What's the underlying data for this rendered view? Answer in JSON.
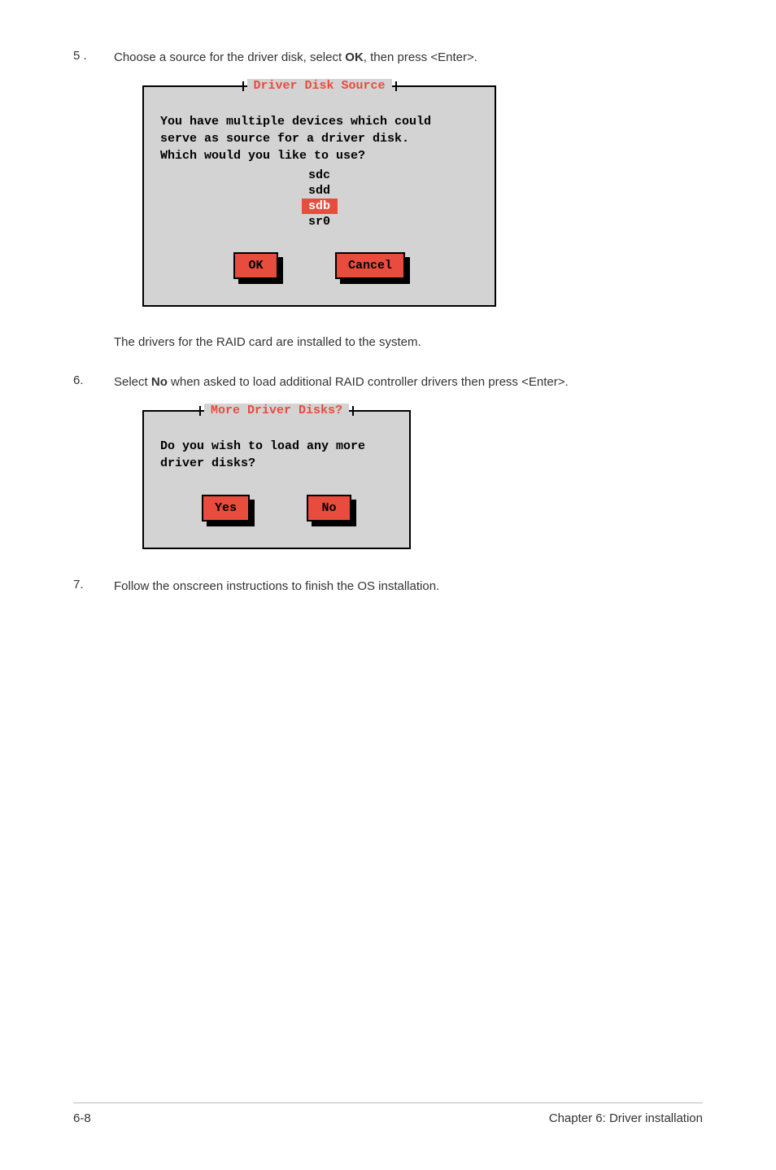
{
  "step5": {
    "number": "5 .",
    "text_before": "Choose a source for the driver disk, select ",
    "bold": "OK",
    "text_after": ", then press <Enter>."
  },
  "dialog1": {
    "title": "Driver Disk Source",
    "line1": "You have multiple devices which could",
    "line2": "serve as source for a driver disk.",
    "line3": "Which would you like to use?",
    "devices": {
      "item0": "sdc",
      "item1": "sdd",
      "item2": "sdb",
      "item3": "sr0"
    },
    "ok": "OK",
    "cancel": "Cancel"
  },
  "followup5": "The drivers for the RAID card are installed to the system.",
  "step6": {
    "number": "6.",
    "text_before": "Select ",
    "bold": "No",
    "text_after": " when asked to load additional RAID controller drivers then press <Enter>."
  },
  "dialog2": {
    "title": "More Driver Disks?",
    "line1": "Do you wish to load any more",
    "line2": "driver disks?",
    "yes": "Yes",
    "no": "No"
  },
  "step7": {
    "number": "7.",
    "text": "Follow the onscreen instructions to finish the OS installation."
  },
  "footer": {
    "left": "6-8",
    "right": "Chapter 6: Driver installation"
  }
}
